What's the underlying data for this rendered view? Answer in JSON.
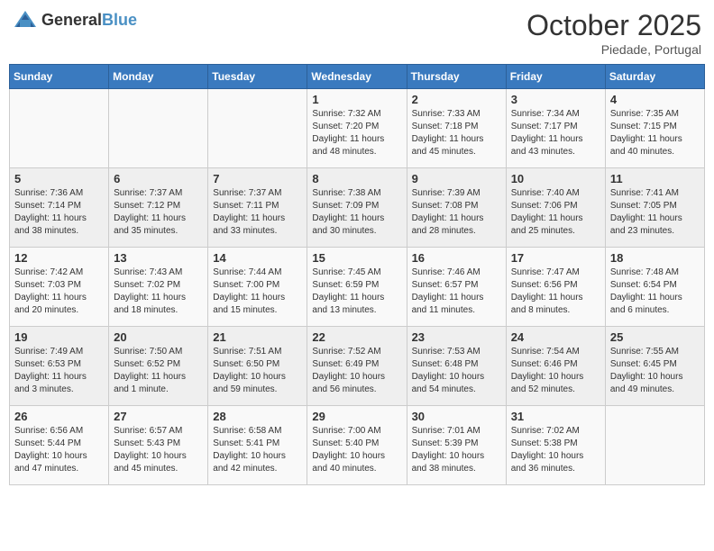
{
  "header": {
    "logo_general": "General",
    "logo_blue": "Blue",
    "month": "October 2025",
    "location": "Piedade, Portugal"
  },
  "weekdays": [
    "Sunday",
    "Monday",
    "Tuesday",
    "Wednesday",
    "Thursday",
    "Friday",
    "Saturday"
  ],
  "weeks": [
    [
      {
        "day": "",
        "info": ""
      },
      {
        "day": "",
        "info": ""
      },
      {
        "day": "",
        "info": ""
      },
      {
        "day": "1",
        "info": "Sunrise: 7:32 AM\nSunset: 7:20 PM\nDaylight: 11 hours\nand 48 minutes."
      },
      {
        "day": "2",
        "info": "Sunrise: 7:33 AM\nSunset: 7:18 PM\nDaylight: 11 hours\nand 45 minutes."
      },
      {
        "day": "3",
        "info": "Sunrise: 7:34 AM\nSunset: 7:17 PM\nDaylight: 11 hours\nand 43 minutes."
      },
      {
        "day": "4",
        "info": "Sunrise: 7:35 AM\nSunset: 7:15 PM\nDaylight: 11 hours\nand 40 minutes."
      }
    ],
    [
      {
        "day": "5",
        "info": "Sunrise: 7:36 AM\nSunset: 7:14 PM\nDaylight: 11 hours\nand 38 minutes."
      },
      {
        "day": "6",
        "info": "Sunrise: 7:37 AM\nSunset: 7:12 PM\nDaylight: 11 hours\nand 35 minutes."
      },
      {
        "day": "7",
        "info": "Sunrise: 7:37 AM\nSunset: 7:11 PM\nDaylight: 11 hours\nand 33 minutes."
      },
      {
        "day": "8",
        "info": "Sunrise: 7:38 AM\nSunset: 7:09 PM\nDaylight: 11 hours\nand 30 minutes."
      },
      {
        "day": "9",
        "info": "Sunrise: 7:39 AM\nSunset: 7:08 PM\nDaylight: 11 hours\nand 28 minutes."
      },
      {
        "day": "10",
        "info": "Sunrise: 7:40 AM\nSunset: 7:06 PM\nDaylight: 11 hours\nand 25 minutes."
      },
      {
        "day": "11",
        "info": "Sunrise: 7:41 AM\nSunset: 7:05 PM\nDaylight: 11 hours\nand 23 minutes."
      }
    ],
    [
      {
        "day": "12",
        "info": "Sunrise: 7:42 AM\nSunset: 7:03 PM\nDaylight: 11 hours\nand 20 minutes."
      },
      {
        "day": "13",
        "info": "Sunrise: 7:43 AM\nSunset: 7:02 PM\nDaylight: 11 hours\nand 18 minutes."
      },
      {
        "day": "14",
        "info": "Sunrise: 7:44 AM\nSunset: 7:00 PM\nDaylight: 11 hours\nand 15 minutes."
      },
      {
        "day": "15",
        "info": "Sunrise: 7:45 AM\nSunset: 6:59 PM\nDaylight: 11 hours\nand 13 minutes."
      },
      {
        "day": "16",
        "info": "Sunrise: 7:46 AM\nSunset: 6:57 PM\nDaylight: 11 hours\nand 11 minutes."
      },
      {
        "day": "17",
        "info": "Sunrise: 7:47 AM\nSunset: 6:56 PM\nDaylight: 11 hours\nand 8 minutes."
      },
      {
        "day": "18",
        "info": "Sunrise: 7:48 AM\nSunset: 6:54 PM\nDaylight: 11 hours\nand 6 minutes."
      }
    ],
    [
      {
        "day": "19",
        "info": "Sunrise: 7:49 AM\nSunset: 6:53 PM\nDaylight: 11 hours\nand 3 minutes."
      },
      {
        "day": "20",
        "info": "Sunrise: 7:50 AM\nSunset: 6:52 PM\nDaylight: 11 hours\nand 1 minute."
      },
      {
        "day": "21",
        "info": "Sunrise: 7:51 AM\nSunset: 6:50 PM\nDaylight: 10 hours\nand 59 minutes."
      },
      {
        "day": "22",
        "info": "Sunrise: 7:52 AM\nSunset: 6:49 PM\nDaylight: 10 hours\nand 56 minutes."
      },
      {
        "day": "23",
        "info": "Sunrise: 7:53 AM\nSunset: 6:48 PM\nDaylight: 10 hours\nand 54 minutes."
      },
      {
        "day": "24",
        "info": "Sunrise: 7:54 AM\nSunset: 6:46 PM\nDaylight: 10 hours\nand 52 minutes."
      },
      {
        "day": "25",
        "info": "Sunrise: 7:55 AM\nSunset: 6:45 PM\nDaylight: 10 hours\nand 49 minutes."
      }
    ],
    [
      {
        "day": "26",
        "info": "Sunrise: 6:56 AM\nSunset: 5:44 PM\nDaylight: 10 hours\nand 47 minutes."
      },
      {
        "day": "27",
        "info": "Sunrise: 6:57 AM\nSunset: 5:43 PM\nDaylight: 10 hours\nand 45 minutes."
      },
      {
        "day": "28",
        "info": "Sunrise: 6:58 AM\nSunset: 5:41 PM\nDaylight: 10 hours\nand 42 minutes."
      },
      {
        "day": "29",
        "info": "Sunrise: 7:00 AM\nSunset: 5:40 PM\nDaylight: 10 hours\nand 40 minutes."
      },
      {
        "day": "30",
        "info": "Sunrise: 7:01 AM\nSunset: 5:39 PM\nDaylight: 10 hours\nand 38 minutes."
      },
      {
        "day": "31",
        "info": "Sunrise: 7:02 AM\nSunset: 5:38 PM\nDaylight: 10 hours\nand 36 minutes."
      },
      {
        "day": "",
        "info": ""
      }
    ]
  ]
}
